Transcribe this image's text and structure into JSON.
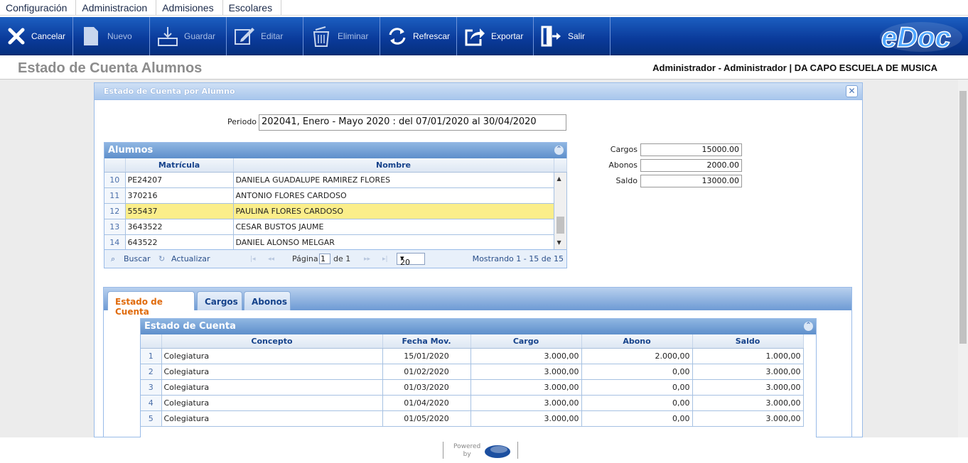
{
  "menu": [
    "Configuración",
    "Administracion",
    "Admisiones",
    "Escolares"
  ],
  "toolbar": {
    "cancel": "Cancelar",
    "new": "Nuevo",
    "save": "Guardar",
    "edit": "Editar",
    "delete": "Eliminar",
    "refresh": "Refrescar",
    "export": "Exportar",
    "exit": "Salir",
    "logo": "eDoc"
  },
  "header": {
    "title": "Estado de Cuenta Alumnos",
    "user": "Administrador - Administrador | DA CAPO ESCUELA DE MUSICA"
  },
  "window": {
    "title": "Estado de Cuenta por Alumno",
    "periodo_label": "Periodo",
    "periodo_value": "202041, Enero - Mayo 2020 : del 07/01/2020 al 30/04/2020"
  },
  "alumnos": {
    "title": "Alumnos",
    "columns": [
      "Matrícula",
      "Nombre"
    ],
    "rows": [
      {
        "n": "10",
        "matricula": "PE24207",
        "nombre": "DANIELA GUADALUPE RAMIREZ FLORES"
      },
      {
        "n": "11",
        "matricula": "370216",
        "nombre": "ANTONIO FLORES CARDOSO"
      },
      {
        "n": "12",
        "matricula": "555437",
        "nombre": "PAULINA FLORES CARDOSO"
      },
      {
        "n": "13",
        "matricula": "3643522",
        "nombre": "CESAR BUSTOS JAUME"
      },
      {
        "n": "14",
        "matricula": "643522",
        "nombre": "DANIEL ALONSO MELGAR"
      }
    ],
    "selected_row": "12",
    "pager": {
      "search": "Buscar",
      "refresh": "Actualizar",
      "page_label": "Página",
      "page": "1",
      "of": "de 1",
      "page_size": "20",
      "showing": "Mostrando 1 - 15 de 15"
    }
  },
  "summary": {
    "cargos_label": "Cargos",
    "cargos": "15000.00",
    "abonos_label": "Abonos",
    "abonos": "2000.00",
    "saldo_label": "Saldo",
    "saldo": "13000.00"
  },
  "tabs": [
    "Estado de Cuenta",
    "Cargos",
    "Abonos"
  ],
  "estado": {
    "title": "Estado de Cuenta",
    "columns": [
      "Concepto",
      "Fecha Mov.",
      "Cargo",
      "Abono",
      "Saldo"
    ],
    "rows": [
      {
        "n": "1",
        "concepto": "Colegiatura",
        "fecha": "15/01/2020",
        "cargo": "3.000,00",
        "abono": "2.000,00",
        "saldo": "1.000,00"
      },
      {
        "n": "2",
        "concepto": "Colegiatura",
        "fecha": "01/02/2020",
        "cargo": "3.000,00",
        "abono": "0,00",
        "saldo": "3.000,00"
      },
      {
        "n": "3",
        "concepto": "Colegiatura",
        "fecha": "01/03/2020",
        "cargo": "3.000,00",
        "abono": "0,00",
        "saldo": "3.000,00"
      },
      {
        "n": "4",
        "concepto": "Colegiatura",
        "fecha": "01/04/2020",
        "cargo": "3.000,00",
        "abono": "0,00",
        "saldo": "3.000,00"
      },
      {
        "n": "5",
        "concepto": "Colegiatura",
        "fecha": "01/05/2020",
        "cargo": "3.000,00",
        "abono": "0,00",
        "saldo": "3.000,00"
      }
    ]
  },
  "footer": {
    "powered": "Powered",
    "by": "by"
  }
}
